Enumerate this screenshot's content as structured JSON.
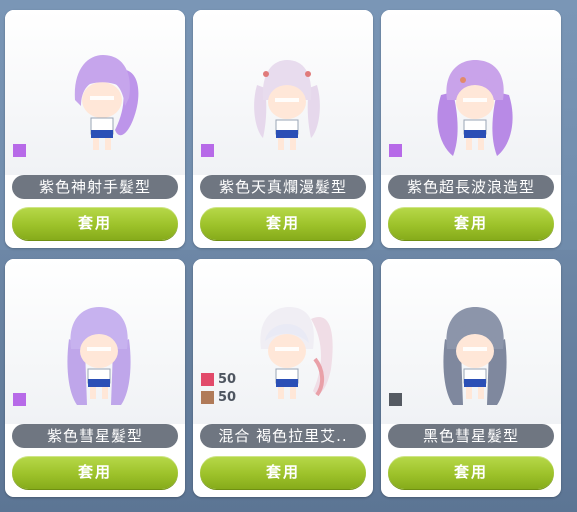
{
  "cards": [
    {
      "name": "紫色神射手髮型",
      "apply_label": "套用",
      "colors": [
        {
          "hex": "#b76ae8",
          "value": ""
        }
      ],
      "hair_color": "#c6a5ec",
      "hair_style": "ponytail",
      "icon": "character-preview"
    },
    {
      "name": "紫色天真爛漫髮型",
      "apply_label": "套用",
      "colors": [
        {
          "hex": "#b76ae8",
          "value": ""
        }
      ],
      "hair_color": "#e8dcee",
      "hair_style": "twintails",
      "icon": "character-preview"
    },
    {
      "name": "紫色超長波浪造型",
      "apply_label": "套用",
      "colors": [
        {
          "hex": "#b76ae8",
          "value": ""
        }
      ],
      "hair_color": "#c9a3ea",
      "hair_style": "long-wavy",
      "icon": "character-preview"
    },
    {
      "name": "紫色彗星髮型",
      "apply_label": "套用",
      "colors": [
        {
          "hex": "#b76ae8",
          "value": ""
        }
      ],
      "hair_color": "#c7b2ef",
      "hair_style": "long-straight",
      "icon": "character-preview"
    },
    {
      "name": "混合 褐色拉里艾..",
      "apply_label": "套用",
      "colors": [
        {
          "hex": "#e24a6a",
          "value": "50"
        },
        {
          "hex": "#b07a58",
          "value": "50"
        }
      ],
      "hair_color": "#f0eef4",
      "hair_style": "side-ponytail",
      "icon": "character-preview"
    },
    {
      "name": "黑色彗星髮型",
      "apply_label": "套用",
      "colors": [
        {
          "hex": "#555a62",
          "value": ""
        }
      ],
      "hair_color": "#8c95aa",
      "hair_style": "long-straight",
      "icon": "character-preview"
    }
  ],
  "close_icon": "close-icon"
}
